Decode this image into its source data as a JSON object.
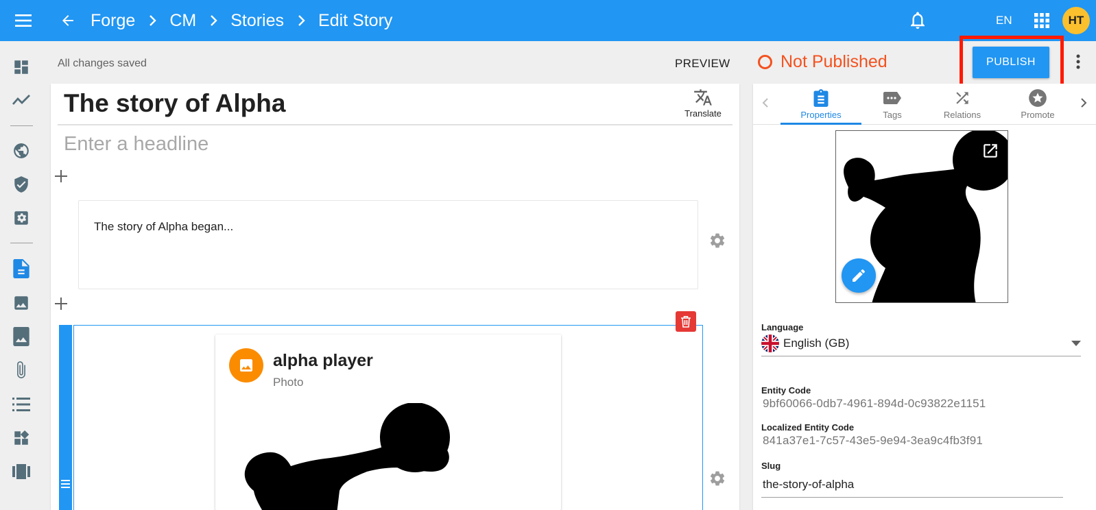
{
  "topbar": {
    "breadcrumbs": [
      "Forge",
      "CM",
      "Stories",
      "Edit Story"
    ],
    "language_code": "EN",
    "avatar_initials": "HT"
  },
  "actionbar": {
    "save_status": "All changes saved",
    "preview_label": "PREVIEW",
    "publish_status": "Not Published",
    "publish_label": "PUBLISH"
  },
  "editor": {
    "title": "The story of Alpha",
    "translate_label": "Translate",
    "headline_placeholder": "Enter a headline",
    "headline_value": "",
    "text_block": "The story of Alpha began...",
    "media_block": {
      "title": "alpha player",
      "type": "Photo"
    }
  },
  "sidepanel": {
    "tabs": [
      {
        "label": "Properties",
        "icon": "clipboard-icon",
        "active": true
      },
      {
        "label": "Tags",
        "icon": "tag-icon",
        "active": false
      },
      {
        "label": "Relations",
        "icon": "shuffle-icon",
        "active": false
      },
      {
        "label": "Promote",
        "icon": "star-badge-icon",
        "active": false
      }
    ],
    "language_label": "Language",
    "language_value": "English (GB)",
    "entity_code_label": "Entity Code",
    "entity_code": "9bf60066-0db7-4961-894d-0c93822e1151",
    "localized_code_label": "Localized Entity Code",
    "localized_code": "841a37e1-7c57-43e5-9e94-3ea9c4fb3f91",
    "slug_label": "Slug",
    "slug_value": "the-story-of-alpha"
  },
  "rail_icons": [
    "dashboard-icon",
    "analytics-icon",
    "globe-icon",
    "shield-check-icon",
    "settings-box-icon",
    "document-icon",
    "image-icon",
    "photo-album-icon",
    "attachment-icon",
    "list-icon",
    "widgets-icon",
    "carousel-icon"
  ],
  "colors": {
    "primary": "#2196f3",
    "status_unpublished": "#f4511e",
    "highlight": "#ff1a00",
    "avatar": "#fbc02d",
    "media_icon": "#fb8c00",
    "delete": "#e53935"
  }
}
